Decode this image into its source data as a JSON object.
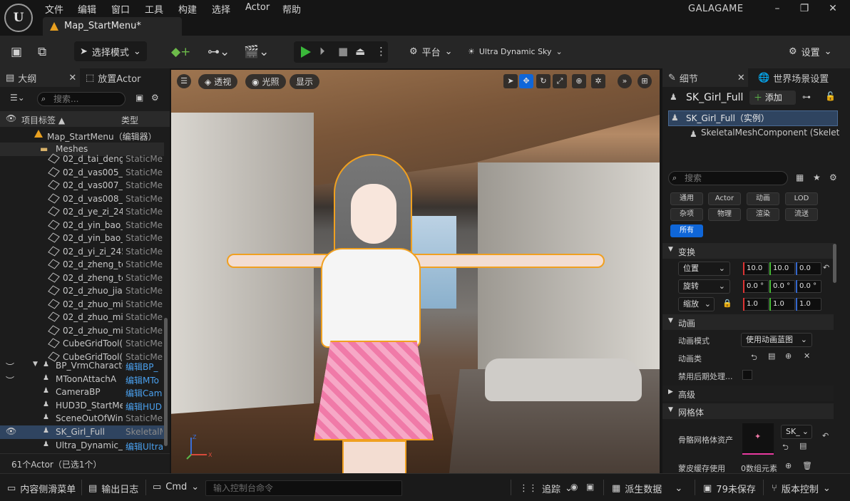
{
  "menu": [
    "文件",
    "编辑",
    "窗口",
    "工具",
    "构建",
    "选择",
    "Actor",
    "帮助"
  ],
  "window_title": "GALAGAME",
  "map_tab": "Map_StartMenu*",
  "toolbar": {
    "mode": "选择模式",
    "platform": "平台",
    "sky": "Ultra Dynamic Sky",
    "settings": "设置"
  },
  "left_panel": {
    "tab_outliner": "大纲",
    "tab_place": "放置Actor",
    "search_placeholder": "搜索...",
    "col_label": "项目标签 ▲",
    "col_type": "类型",
    "map_row": "Map_StartMenu（编辑器）",
    "folder": "Meshes",
    "rows": [
      {
        "name": "02_d_tai_deng",
        "type": "StaticMe"
      },
      {
        "name": "02_d_vas005_",
        "type": "StaticMe"
      },
      {
        "name": "02_d_vas007_",
        "type": "StaticMe"
      },
      {
        "name": "02_d_vas008_",
        "type": "StaticMe"
      },
      {
        "name": "02_d_ye_zi_24",
        "type": "StaticMe"
      },
      {
        "name": "02_d_yin_bao_",
        "type": "StaticMe"
      },
      {
        "name": "02_d_yin_bao_",
        "type": "StaticMe"
      },
      {
        "name": "02_d_yi_zi_245",
        "type": "StaticMe"
      },
      {
        "name": "02_d_zheng_tc",
        "type": "StaticMe"
      },
      {
        "name": "02_d_zheng_tc",
        "type": "StaticMe"
      },
      {
        "name": "02_d_zhuo_jia",
        "type": "StaticMe"
      },
      {
        "name": "02_d_zhuo_mi",
        "type": "StaticMe"
      },
      {
        "name": "02_d_zhuo_mi",
        "type": "StaticMe"
      },
      {
        "name": "02_d_zhuo_mi",
        "type": "StaticMe"
      },
      {
        "name": "CubeGridTool(",
        "type": "StaticMe"
      },
      {
        "name": "CubeGridTool(",
        "type": "StaticMe"
      }
    ],
    "rows2": [
      {
        "name": "BP_VrmCharacte",
        "type": "编辑BP_",
        "link": true
      },
      {
        "name": "MToonAttachA",
        "type": "编辑MTo",
        "link": true
      },
      {
        "name": "CameraBP",
        "type": "编辑Cam",
        "link": true
      },
      {
        "name": "HUD3D_StartMe",
        "type": "编辑HUD",
        "link": true
      },
      {
        "name": "SceneOutOfWinc",
        "type": "StaticMe",
        "link": false
      },
      {
        "name": "SK_Girl_Full",
        "type": "SkeletalM",
        "link": false
      },
      {
        "name": "Ultra_Dynamic_S",
        "type": "编辑Ultra",
        "link": true
      }
    ],
    "footer": "61个Actor（已选1个）"
  },
  "viewport": {
    "perspective": "透视",
    "lit": "光照",
    "show": "显示"
  },
  "right_panel": {
    "tab_details": "细节",
    "tab_world": "世界场景设置",
    "actor_name": "SK_Girl_Full",
    "add": "添加",
    "instance": "SK_Girl_Full（实例）",
    "component": "SkeletalMeshComponent (SkeletalM",
    "search_placeholder": "搜索",
    "categories": [
      "通用",
      "Actor",
      "动画",
      "LOD",
      "杂项",
      "物理",
      "渲染",
      "流送",
      "所有"
    ],
    "sec_transform": "变换",
    "location": "位置",
    "rotation": "旋转",
    "scale": "缩放",
    "loc_vals": [
      "10.0",
      "10.0",
      "0.0"
    ],
    "rot_vals": [
      "0.0 °",
      "0.0 °",
      "0.0 °"
    ],
    "scale_vals": [
      "1.0",
      "1.0",
      "1.0"
    ],
    "sec_anim": "动画",
    "anim_mode_label": "动画模式",
    "anim_mode_value": "使用动画蓝图",
    "anim_class_label": "动画类",
    "disable_post": "禁用后期处理...",
    "sec_advanced": "高级",
    "sec_mesh": "网格体",
    "mesh_asset_label": "骨骼网格体资产",
    "mesh_asset_value": "SK_",
    "skin_cache_label": "蒙皮缓存使用",
    "skin_cache_value": "0数组元素"
  },
  "statusbar": {
    "content_drawer": "内容侧滑菜单",
    "output_log": "输出日志",
    "cmd": "Cmd",
    "console_placeholder": "输入控制台命令",
    "trace": "追踪",
    "derived": "派生数据",
    "unsaved": "79未保存",
    "source_control": "版本控制"
  },
  "colors": {
    "accent_blue": "#0f66d8",
    "selection_orange": "#f0a020",
    "play_green": "#3ab83a"
  }
}
